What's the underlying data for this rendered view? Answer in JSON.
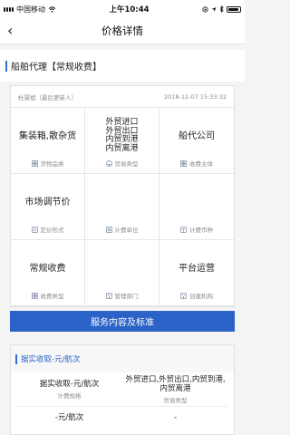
{
  "status": {
    "carrier": "中国移动",
    "time": "上午10:44"
  },
  "nav": {
    "back": "‹",
    "title": "价格详情"
  },
  "section": {
    "title": "船舶代理【常规收费】"
  },
  "meta": {
    "author": "杜慧斌（最后更新人）",
    "timestamp": "2018-12-07 15:33:32"
  },
  "grid": [
    {
      "value": "集装箱,散杂货",
      "label": "货物品类",
      "icon": "grid-icon"
    },
    {
      "value": "外贸进口\n外贸出口\n内贸到港\n内贸离港",
      "label": "贸易类型",
      "icon": "ship-icon"
    },
    {
      "value": "船代公司",
      "label": "收费主体",
      "icon": "grid-icon"
    },
    {
      "value": "市场调节价",
      "label": "定价形式",
      "icon": "tag-icon"
    },
    {
      "value": "",
      "label": "计费单位",
      "icon": "unit-icon"
    },
    {
      "value": "",
      "label": "计费币种",
      "icon": "currency-icon"
    },
    {
      "value": "常规收费",
      "label": "收费类型",
      "icon": "grid-icon"
    },
    {
      "value": "",
      "label": "管理部门",
      "icon": "building-icon"
    },
    {
      "value": "平台运营",
      "label": "创建机构",
      "icon": "building-icon"
    }
  ],
  "service_button": "服务内容及标准",
  "detail": {
    "title": "据实收取-元/航次",
    "rows": [
      {
        "left_value": "据实收取-元/航次",
        "left_label": "计费规格",
        "right_value": "外贸进口,外贸出口,内贸到港,内贸离港",
        "right_label": "贸易类型"
      },
      {
        "left_value": "-元/航次",
        "left_label": "",
        "right_value": "-",
        "right_label": ""
      }
    ]
  },
  "colors": {
    "accent": "#2a62c7",
    "muted": "#8c8c8c"
  }
}
